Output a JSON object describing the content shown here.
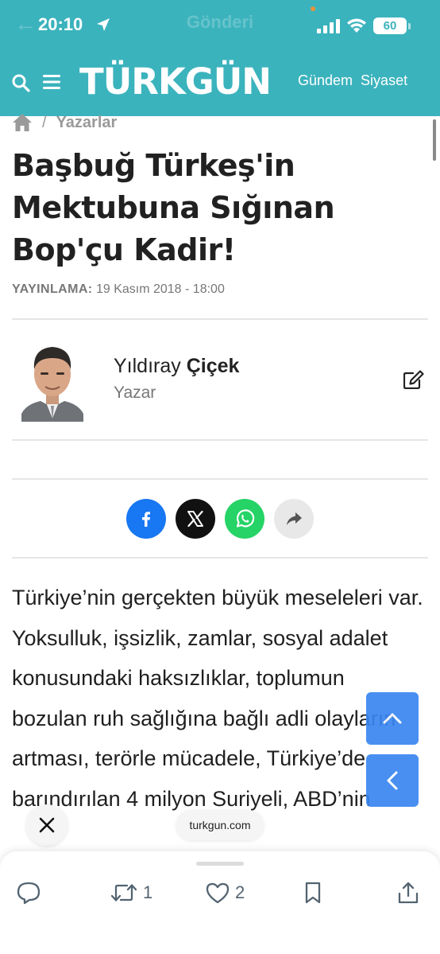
{
  "status_bar": {
    "time": "20:10",
    "battery": "60",
    "underlay_title": "Gönderi"
  },
  "nav": {
    "logo": "TÜRKGÜN",
    "links": [
      "Gündem",
      "Siyaset"
    ]
  },
  "breadcrumb": {
    "section": "Yazarlar"
  },
  "article": {
    "title": "Başbuğ Türkeş'in Mektubuna Sığınan Bop'çu Kadir!",
    "published_label": "YAYINLAMA:",
    "published_date": "19 Kasım 2018 - 18:00",
    "author_first": "Yıldıray",
    "author_last": "Çiçek",
    "author_role": "Yazar",
    "body": "Türkiye’nin gerçekten büyük meseleleri var. Yoksulluk, işsizlik, zamlar, sosyal adalet konusundaki haksızlıklar, toplumun bozulan ruh sağlığına bağlı adli olayların artması, terörle mücadele, Türkiye’de barındırılan 4 milyon Suriyeli, ABD’nin"
  },
  "share": [
    "facebook-icon",
    "x-icon",
    "whatsapp-icon",
    "share-arrow-icon"
  ],
  "browser": {
    "url": "turkgun.com"
  },
  "actions": {
    "retweet_count": "1",
    "like_count": "2"
  },
  "colors": {
    "header": "#3bb3bd",
    "facebook": "#1877f2",
    "x": "#111111",
    "whatsapp": "#25d366",
    "scroll_button": "#3a86f0"
  }
}
